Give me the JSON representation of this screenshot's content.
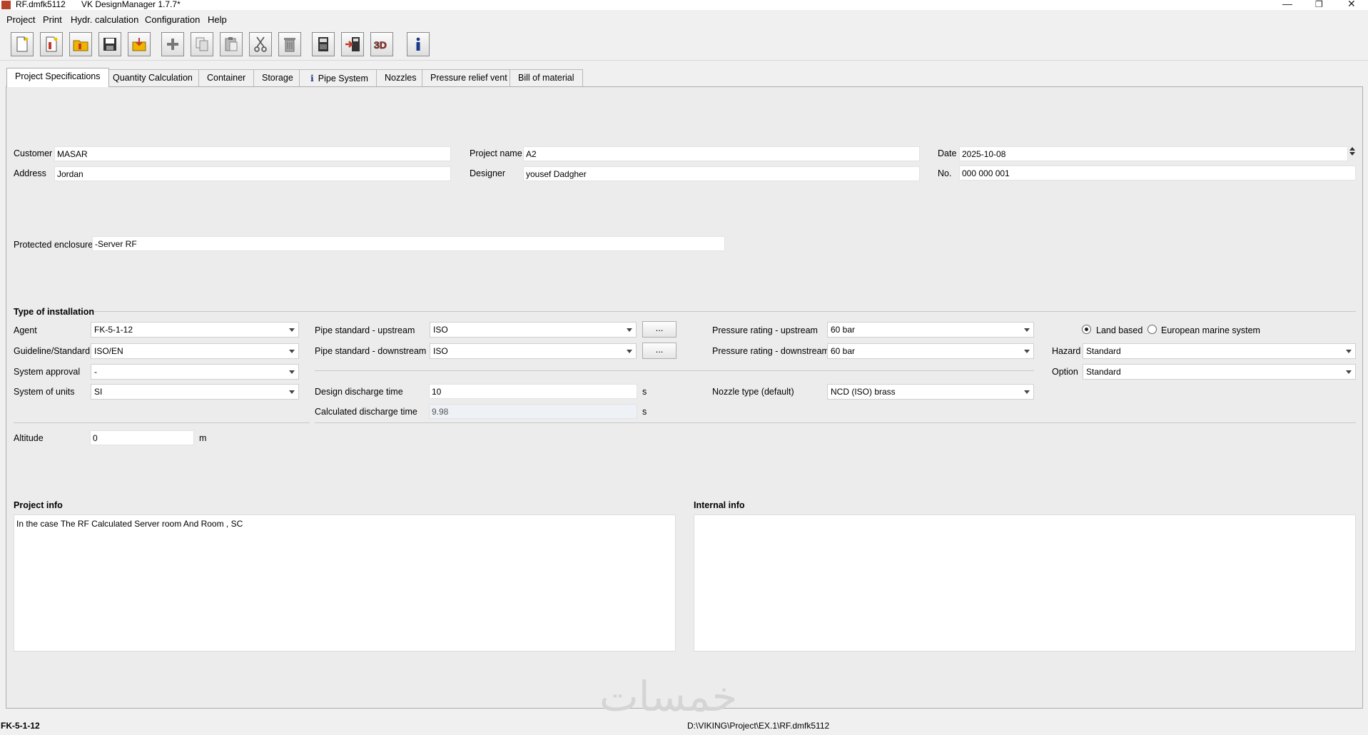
{
  "window": {
    "file": "RF.dmfk5112",
    "title": "VK DesignManager 1.7.7*"
  },
  "menu": [
    "Project",
    "Print",
    "Hydr. calculation",
    "Configuration",
    "Help"
  ],
  "toolbar_icons": [
    "new-doc-icon",
    "new-project-icon",
    "open-folder-icon",
    "save-icon",
    "import-icon",
    "add-icon",
    "copy-icon",
    "paste-icon",
    "cut-icon",
    "delete-icon",
    "calculator-icon",
    "export-calc-icon",
    "3d-view-icon",
    "info-icon"
  ],
  "tabs": [
    "Project Specifications",
    "Quantity Calculation",
    "Container",
    "Storage",
    "Pipe System",
    "Nozzles",
    "Pressure relief vent",
    "Bill of material"
  ],
  "project": {
    "customer_label": "Customer",
    "customer": "MASAR",
    "address_label": "Address",
    "address": "Jordan",
    "project_name_label": "Project name",
    "project_name": "A2",
    "designer_label": "Designer",
    "designer": "yousef Dadgher",
    "date_label": "Date",
    "date": "2025-10-08",
    "no_label": "No.",
    "no": "000 000 001",
    "enclosure_label": "Protected enclosure",
    "enclosure": "-Server RF"
  },
  "installation": {
    "heading": "Type of installation",
    "agent_label": "Agent",
    "agent": "FK-5-1-12",
    "guideline_label": "Guideline/Standard",
    "guideline": "ISO/EN",
    "approval_label": "System approval",
    "approval": "-",
    "units_label": "System of units",
    "units": "SI",
    "pipe_up_label": "Pipe standard - upstream",
    "pipe_up": "ISO",
    "pipe_down_label": "Pipe standard - downstream",
    "pipe_down": "ISO",
    "dots": "...",
    "pr_up_label": "Pressure rating - upstream",
    "pr_up": "60 bar",
    "pr_down_label": "Pressure rating - downstream",
    "pr_down": "60 bar",
    "design_time_label": "Design discharge time",
    "design_time": "10",
    "calc_time_label": "Calculated discharge time",
    "calc_time": "9.98",
    "sec_unit": "s",
    "nozzle_label": "Nozzle type (default)",
    "nozzle": "NCD (ISO) brass",
    "land_based": "Land based",
    "marine": "European marine system",
    "hazard_label": "Hazard",
    "hazard": "Standard",
    "option_label": "Option",
    "option": "Standard",
    "altitude_label": "Altitude",
    "altitude": "0",
    "altitude_unit": "m"
  },
  "info": {
    "project_info_label": "Project info",
    "project_info": "In the case The RF Calculated Server room And Room , SC",
    "internal_info_label": "Internal info",
    "internal_info": ""
  },
  "status": {
    "left": "FK-5-1-12",
    "path": "D:\\VIKING\\Project\\EX.1\\RF.dmfk5112"
  },
  "watermark": "خمسات"
}
